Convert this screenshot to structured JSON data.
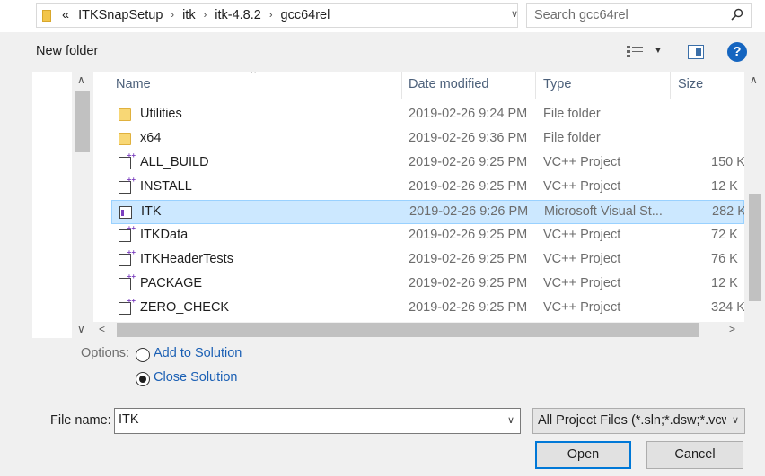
{
  "address": {
    "overflow": "«",
    "breadcrumbs": [
      "ITKSnapSetup",
      "itk",
      "itk-4.8.2",
      "gcc64rel"
    ],
    "separator": "›",
    "dropdown": "∨",
    "refresh": "↻"
  },
  "search": {
    "placeholder": "Search gcc64rel"
  },
  "toolbar": {
    "new_folder": "New folder",
    "view_dropdown": "▼",
    "help": "?"
  },
  "columns": {
    "name": "Name",
    "date": "Date modified",
    "type": "Type",
    "size": "Size"
  },
  "files": [
    {
      "name": "Utilities",
      "date": "2019-02-26 9:24 PM",
      "type": "File folder",
      "size": "",
      "icon": "folder-icon"
    },
    {
      "name": "x64",
      "date": "2019-02-26 9:36 PM",
      "type": "File folder",
      "size": "",
      "icon": "folder-icon"
    },
    {
      "name": "ALL_BUILD",
      "date": "2019-02-26 9:25 PM",
      "type": "VC++ Project",
      "size": "150 K",
      "icon": "vcxproj-icon"
    },
    {
      "name": "INSTALL",
      "date": "2019-02-26 9:25 PM",
      "type": "VC++ Project",
      "size": "12 K",
      "icon": "vcxproj-icon"
    },
    {
      "name": "ITK",
      "date": "2019-02-26 9:26 PM",
      "type": "Microsoft Visual St...",
      "size": "282 K",
      "icon": "solution-icon",
      "selected": true
    },
    {
      "name": "ITKData",
      "date": "2019-02-26 9:25 PM",
      "type": "VC++ Project",
      "size": "72 K",
      "icon": "vcxproj-icon"
    },
    {
      "name": "ITKHeaderTests",
      "date": "2019-02-26 9:25 PM",
      "type": "VC++ Project",
      "size": "76 K",
      "icon": "vcxproj-icon"
    },
    {
      "name": "PACKAGE",
      "date": "2019-02-26 9:25 PM",
      "type": "VC++ Project",
      "size": "12 K",
      "icon": "vcxproj-icon"
    },
    {
      "name": "ZERO_CHECK",
      "date": "2019-02-26 9:25 PM",
      "type": "VC++ Project",
      "size": "324 K",
      "icon": "vcxproj-icon"
    }
  ],
  "options": {
    "label": "Options:",
    "add_to_solution": "Add to Solution",
    "close_solution": "Close Solution",
    "selected": "close_solution"
  },
  "file_name": {
    "label": "File name:",
    "value": "ITK"
  },
  "filter": {
    "value": "All Project Files (*.sln;*.dsw;*.vcw"
  },
  "buttons": {
    "open": "Open",
    "cancel": "Cancel"
  },
  "colors": {
    "selection": "#cce8ff",
    "accent": "#0078d7",
    "link": "#1a5fb4"
  }
}
